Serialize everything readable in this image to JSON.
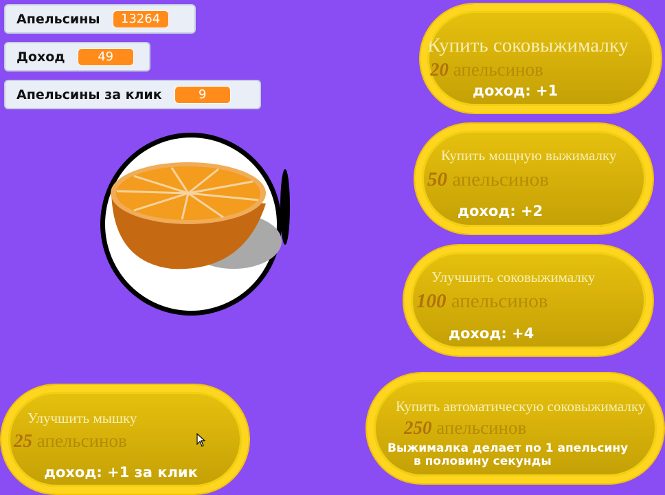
{
  "monitors": {
    "oranges": {
      "label": "Апельсины",
      "value": "13264"
    },
    "income": {
      "label": "Доход",
      "value": "49"
    },
    "per_click": {
      "label": "Апельсины за клик",
      "value": "9"
    }
  },
  "shop": {
    "juicer": {
      "title": "Купить соковыжималку",
      "cost": "20",
      "cost_unit": "апельсинов",
      "income": "доход: +1"
    },
    "power_juicer": {
      "title": "Купить мощную выжималку",
      "cost": "50",
      "cost_unit": "апельсинов",
      "income": "доход: +2"
    },
    "upgrade_juicer": {
      "title": "Улучшить соковыжималку",
      "cost": "100",
      "cost_unit": "апельсинов",
      "income": "доход: +4"
    },
    "upgrade_mouse": {
      "title": "Улучшить мышку",
      "cost": "25",
      "cost_unit": "апельсинов",
      "income": "доход: +1 за клик"
    },
    "auto_juicer": {
      "title": "Купить автоматическую соковыжималку",
      "cost": "250",
      "cost_unit": "апельсинов",
      "desc_line1": "Выжималка делает  по 1 апельсину",
      "desc_line2": "в половину секунды"
    }
  },
  "colors": {
    "background": "#8a4cf3",
    "button_fill": "#d8b20a",
    "button_border": "#ffd61f",
    "monitor_value": "#ff8c1a"
  },
  "icons": {
    "clicker": "orange-half-icon",
    "pointer": "mouse-cursor-icon"
  }
}
